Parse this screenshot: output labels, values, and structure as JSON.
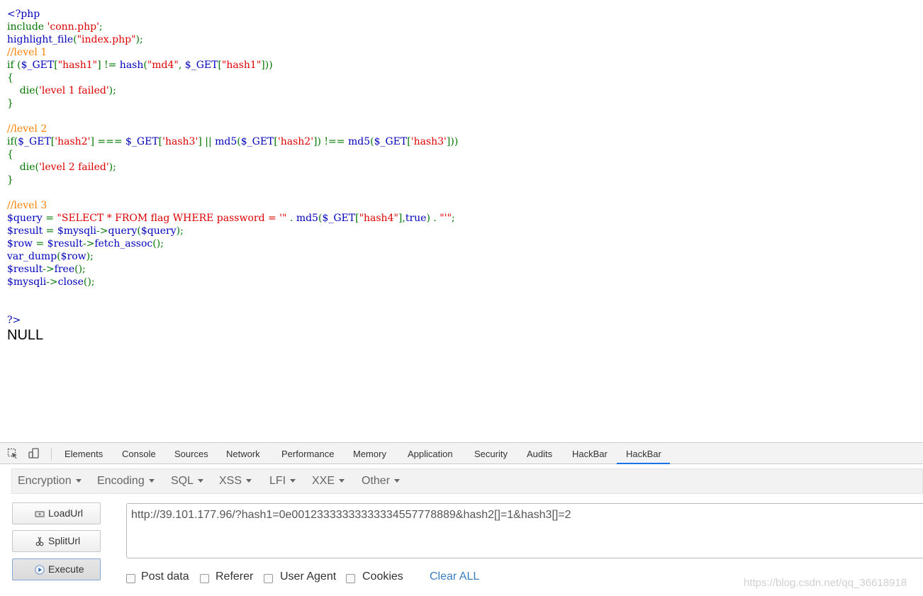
{
  "code": {
    "lines": [
      [
        {
          "t": "<?php",
          "c": "c-blue"
        }
      ],
      [
        {
          "t": "include ",
          "c": "c-green"
        },
        {
          "t": "'conn.php'",
          "c": "c-red"
        },
        {
          "t": ";",
          "c": "c-green"
        }
      ],
      [
        {
          "t": "highlight_file",
          "c": "c-blue"
        },
        {
          "t": "(",
          "c": "c-green"
        },
        {
          "t": "\"index.php\"",
          "c": "c-red"
        },
        {
          "t": ");",
          "c": "c-green"
        }
      ],
      [
        {
          "t": "//level 1",
          "c": "c-orange"
        }
      ],
      [
        {
          "t": "if ",
          "c": "c-green"
        },
        {
          "t": "(",
          "c": "c-green"
        },
        {
          "t": "$_GET",
          "c": "c-blue"
        },
        {
          "t": "[",
          "c": "c-green"
        },
        {
          "t": "\"hash1\"",
          "c": "c-red"
        },
        {
          "t": "] ",
          "c": "c-green"
        },
        {
          "t": "!= ",
          "c": "c-green"
        },
        {
          "t": "hash",
          "c": "c-blue"
        },
        {
          "t": "(",
          "c": "c-green"
        },
        {
          "t": "\"md4\"",
          "c": "c-red"
        },
        {
          "t": ", ",
          "c": "c-green"
        },
        {
          "t": "$_GET",
          "c": "c-blue"
        },
        {
          "t": "[",
          "c": "c-green"
        },
        {
          "t": "\"hash1\"",
          "c": "c-red"
        },
        {
          "t": "]))",
          "c": "c-green"
        }
      ],
      [
        {
          "t": "{",
          "c": "c-green"
        }
      ],
      [
        {
          "t": "    die",
          "c": "c-green"
        },
        {
          "t": "(",
          "c": "c-green"
        },
        {
          "t": "'level 1 failed'",
          "c": "c-red"
        },
        {
          "t": ");",
          "c": "c-green"
        }
      ],
      [
        {
          "t": "}",
          "c": "c-green"
        }
      ],
      [
        {
          "t": "",
          "c": "c-black"
        }
      ],
      [
        {
          "t": "//level 2",
          "c": "c-orange"
        }
      ],
      [
        {
          "t": "if",
          "c": "c-green"
        },
        {
          "t": "(",
          "c": "c-green"
        },
        {
          "t": "$_GET",
          "c": "c-blue"
        },
        {
          "t": "[",
          "c": "c-green"
        },
        {
          "t": "'hash2'",
          "c": "c-red"
        },
        {
          "t": "] ",
          "c": "c-green"
        },
        {
          "t": "=== ",
          "c": "c-green"
        },
        {
          "t": "$_GET",
          "c": "c-blue"
        },
        {
          "t": "[",
          "c": "c-green"
        },
        {
          "t": "'hash3'",
          "c": "c-red"
        },
        {
          "t": "] ",
          "c": "c-green"
        },
        {
          "t": "|| ",
          "c": "c-green"
        },
        {
          "t": "md5",
          "c": "c-blue"
        },
        {
          "t": "(",
          "c": "c-green"
        },
        {
          "t": "$_GET",
          "c": "c-blue"
        },
        {
          "t": "[",
          "c": "c-green"
        },
        {
          "t": "'hash2'",
          "c": "c-red"
        },
        {
          "t": "]) ",
          "c": "c-green"
        },
        {
          "t": "!== ",
          "c": "c-green"
        },
        {
          "t": "md5",
          "c": "c-blue"
        },
        {
          "t": "(",
          "c": "c-green"
        },
        {
          "t": "$_GET",
          "c": "c-blue"
        },
        {
          "t": "[",
          "c": "c-green"
        },
        {
          "t": "'hash3'",
          "c": "c-red"
        },
        {
          "t": "]))",
          "c": "c-green"
        }
      ],
      [
        {
          "t": "{",
          "c": "c-green"
        }
      ],
      [
        {
          "t": "    die",
          "c": "c-green"
        },
        {
          "t": "(",
          "c": "c-green"
        },
        {
          "t": "'level 2 failed'",
          "c": "c-red"
        },
        {
          "t": ");",
          "c": "c-green"
        }
      ],
      [
        {
          "t": "}",
          "c": "c-green"
        }
      ],
      [
        {
          "t": "",
          "c": "c-black"
        }
      ],
      [
        {
          "t": "//level 3",
          "c": "c-orange"
        }
      ],
      [
        {
          "t": "$query ",
          "c": "c-blue"
        },
        {
          "t": "= ",
          "c": "c-green"
        },
        {
          "t": "\"SELECT * FROM flag WHERE password = '\" ",
          "c": "c-red"
        },
        {
          "t": ". ",
          "c": "c-green"
        },
        {
          "t": "md5",
          "c": "c-blue"
        },
        {
          "t": "(",
          "c": "c-green"
        },
        {
          "t": "$_GET",
          "c": "c-blue"
        },
        {
          "t": "[",
          "c": "c-green"
        },
        {
          "t": "\"hash4\"",
          "c": "c-red"
        },
        {
          "t": "],",
          "c": "c-green"
        },
        {
          "t": "true",
          "c": "c-blue"
        },
        {
          "t": ") ",
          "c": "c-green"
        },
        {
          "t": ". ",
          "c": "c-green"
        },
        {
          "t": "\"'\"",
          "c": "c-red"
        },
        {
          "t": ";",
          "c": "c-green"
        }
      ],
      [
        {
          "t": "$result ",
          "c": "c-blue"
        },
        {
          "t": "= ",
          "c": "c-green"
        },
        {
          "t": "$mysqli",
          "c": "c-blue"
        },
        {
          "t": "->",
          "c": "c-green"
        },
        {
          "t": "query",
          "c": "c-blue"
        },
        {
          "t": "(",
          "c": "c-green"
        },
        {
          "t": "$query",
          "c": "c-blue"
        },
        {
          "t": ");",
          "c": "c-green"
        }
      ],
      [
        {
          "t": "$row ",
          "c": "c-blue"
        },
        {
          "t": "= ",
          "c": "c-green"
        },
        {
          "t": "$result",
          "c": "c-blue"
        },
        {
          "t": "->",
          "c": "c-green"
        },
        {
          "t": "fetch_assoc",
          "c": "c-blue"
        },
        {
          "t": "();",
          "c": "c-green"
        }
      ],
      [
        {
          "t": "var_dump",
          "c": "c-blue"
        },
        {
          "t": "(",
          "c": "c-green"
        },
        {
          "t": "$row",
          "c": "c-blue"
        },
        {
          "t": ");",
          "c": "c-green"
        }
      ],
      [
        {
          "t": "$result",
          "c": "c-blue"
        },
        {
          "t": "->",
          "c": "c-green"
        },
        {
          "t": "free",
          "c": "c-blue"
        },
        {
          "t": "();",
          "c": "c-green"
        }
      ],
      [
        {
          "t": "$mysqli",
          "c": "c-blue"
        },
        {
          "t": "->",
          "c": "c-green"
        },
        {
          "t": "close",
          "c": "c-blue"
        },
        {
          "t": "();",
          "c": "c-green"
        }
      ],
      [
        {
          "t": "",
          "c": "c-black"
        }
      ],
      [
        {
          "t": "",
          "c": "c-black"
        }
      ],
      [
        {
          "t": "?>",
          "c": "c-blue"
        }
      ]
    ]
  },
  "output": {
    "text": "NULL"
  },
  "devtools": {
    "tabs": [
      "Elements",
      "Console",
      "Sources",
      "Network",
      "Performance",
      "Memory",
      "Application",
      "Security",
      "Audits",
      "HackBar",
      "HackBar"
    ],
    "active_tab_index": 10
  },
  "hackbar": {
    "menus": [
      "Encryption",
      "Encoding",
      "SQL",
      "XSS",
      "LFI",
      "XXE",
      "Other"
    ],
    "buttons": {
      "load": "LoadUrl",
      "split": "SplitUrl",
      "execute": "Execute"
    },
    "url": "http://39.101.177.96/?hash1=0e00123333333333334557778889&hash2[]=1&hash3[]=2",
    "options": [
      "Post data",
      "Referer",
      "User Agent",
      "Cookies"
    ],
    "clear_all": "Clear ALL"
  },
  "watermark": "https://blog.csdn.net/qq_36618918",
  "colors": {
    "accent": "#1a73e8",
    "link": "#3a7ebf"
  }
}
